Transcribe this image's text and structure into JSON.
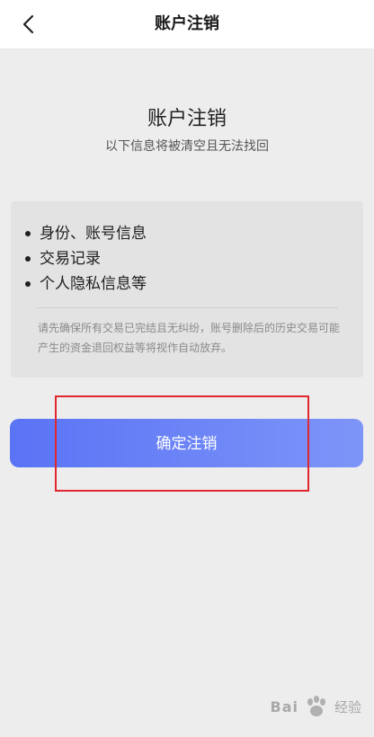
{
  "navbar": {
    "title": "账户注销",
    "back_icon": "chevron-left-icon"
  },
  "main": {
    "heading": "账户注销",
    "subheading": "以下信息将被清空且无法找回",
    "items": [
      {
        "label": "身份、账号信息"
      },
      {
        "label": "交易记录"
      },
      {
        "label": "个人隐私信息等"
      }
    ],
    "notice": "请先确保所有交易已完结且无纠纷，账号删除后的历史交易可能产生的资金退回权益等将视作自动放弃。",
    "confirm_label": "确定注销"
  },
  "watermark": {
    "logo_text": "Bai",
    "suffix_text": "经验"
  },
  "colors": {
    "button_start": "#5a73f5",
    "button_end": "#7d95f8",
    "highlight": "#e0262e"
  }
}
